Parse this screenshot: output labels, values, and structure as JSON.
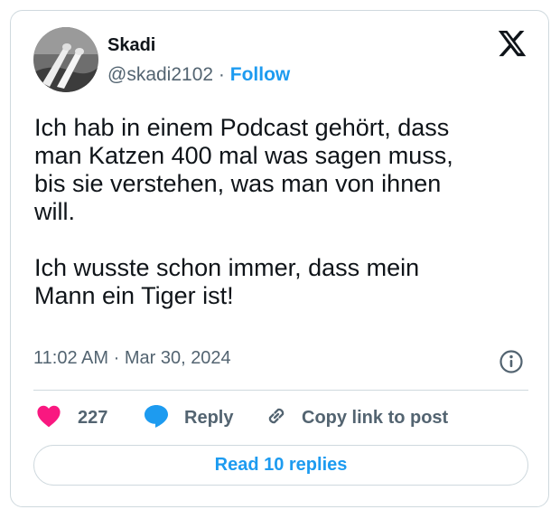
{
  "author": {
    "name": "Skadi",
    "handle": "@skadi2102",
    "separator": "·",
    "follow_label": "Follow"
  },
  "post": {
    "text": "Ich hab in einem Podcast gehört, dass\nman Katzen 400 mal was sagen muss,\nbis sie verstehen, was man von ihnen\nwill.\n\nIch wusste schon immer, dass mein\nMann ein Tiger ist!",
    "time": "11:02 AM",
    "date": "Mar 30, 2024"
  },
  "actions": {
    "like_count": "227",
    "reply_label": "Reply",
    "copy_label": "Copy link to post"
  },
  "read_replies_label": "Read 10 replies",
  "icons": {
    "logo": "x-logo-icon",
    "info": "info-icon",
    "like": "heart-icon",
    "reply": "speech-bubble-icon",
    "copy": "link-icon"
  },
  "colors": {
    "accent": "#1d9bf0",
    "heart": "#f91880",
    "text": "#0f1419",
    "muted": "#536471",
    "border": "#cfd9de"
  }
}
